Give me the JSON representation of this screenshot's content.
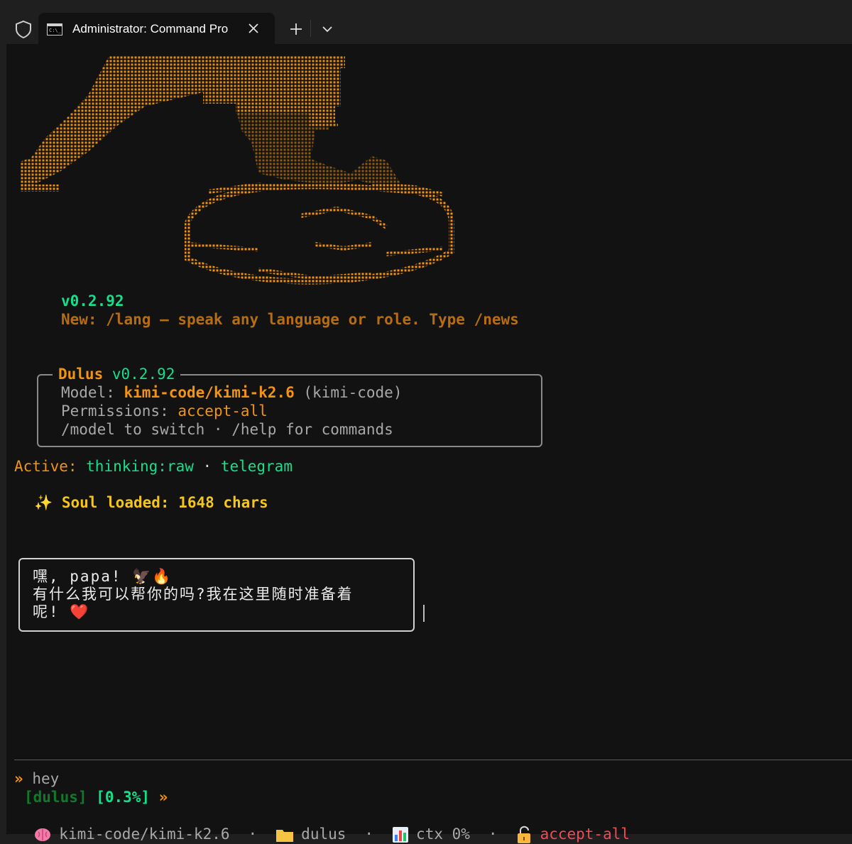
{
  "window": {
    "tab_title": "Administrator: Command Pro"
  },
  "version_line": "v0.2.92",
  "news": {
    "prefix": "New: ",
    "text": "/lang — speak any language or role. Type /news"
  },
  "info_box": {
    "title_name": "Dulus",
    "title_version": "v0.2.92",
    "model_label": "Model: ",
    "model_value": "kimi-code/kimi-k2.6",
    "model_provider": "(kimi-code)",
    "permissions_label": "Permissions: ",
    "permissions_value": "accept-all",
    "help_text": "/model to switch · /help for commands"
  },
  "active": {
    "label": "Active: ",
    "items": [
      "thinking:raw",
      "telegram"
    ],
    "separator": " · "
  },
  "soul": {
    "icon": "✨",
    "text": "Soul loaded: 1648 chars"
  },
  "assistant_message": {
    "line1": "嘿, papa! 🦅🔥",
    "line2": "有什么我可以帮你的吗?我在这里随时准备着",
    "line3": "呢! ❤️"
  },
  "prompt": {
    "marker": "»",
    "input": "hey",
    "project_tag": "[dulus]",
    "usage": "[0.3%]",
    "arrow": "»"
  },
  "status_bar": {
    "model_icon": "brain-icon",
    "model": "kimi-code/kimi-k2.6",
    "folder_icon": "folder-icon",
    "folder": "dulus",
    "ctx_icon": "chart-icon",
    "ctx": "ctx 0%",
    "lock_icon": "unlock-icon",
    "permissions": "accept-all",
    "separator": "·"
  },
  "colors": {
    "background": "#121212",
    "accent_orange": "#f29314",
    "accent_green": "#13e08a",
    "accent_red": "#f04b55"
  }
}
